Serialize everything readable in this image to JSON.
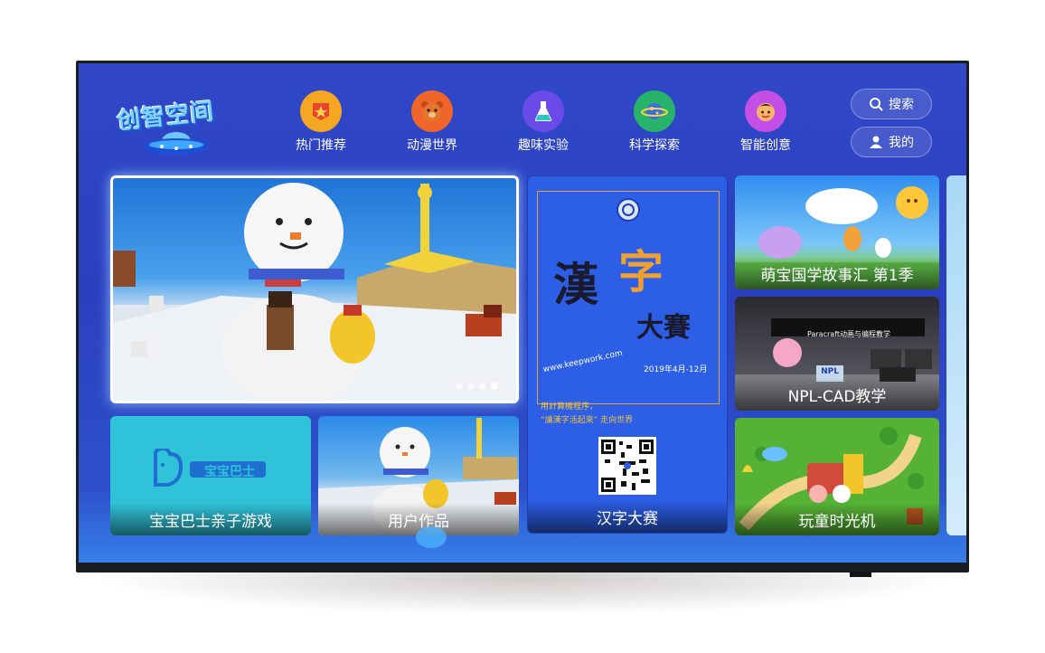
{
  "app": {
    "logo_text": "创智空间"
  },
  "nav": [
    {
      "label": "热门推荐",
      "icon": "star-icon",
      "color": "#f5a623"
    },
    {
      "label": "动漫世界",
      "icon": "bear-icon",
      "color": "#f0662a"
    },
    {
      "label": "趣味实验",
      "icon": "flask-icon",
      "color": "#6a4be8"
    },
    {
      "label": "科学探索",
      "icon": "planet-icon",
      "color": "#27b36a"
    },
    {
      "label": "智能创意",
      "icon": "face-icon",
      "color": "#c34fe6"
    }
  ],
  "actions": {
    "search_label": "搜索",
    "profile_label": "我的"
  },
  "cards": {
    "small1_label": "宝宝巴士亲子游戏",
    "small1_logo": "宝宝巴士",
    "small2_label": "用户作品",
    "poster_label": "汉字大赛",
    "right1_label": "萌宝国学故事汇 第1季",
    "right2_label": "NPL-CAD教学",
    "right2_banner": "Paracraft动画与编程教学",
    "right2_sign": "NPL",
    "right3_label": "玩童时光机"
  },
  "poster": {
    "title1": "漢",
    "title2": "字",
    "title3": "大賽",
    "url": "www.keepwork.com",
    "date": "2019年4月-12月",
    "sub1": "用計算機程序，",
    "sub2": "“讓漢字活起來” 走向世界"
  },
  "carousel": {
    "count": 4,
    "active": 4
  }
}
